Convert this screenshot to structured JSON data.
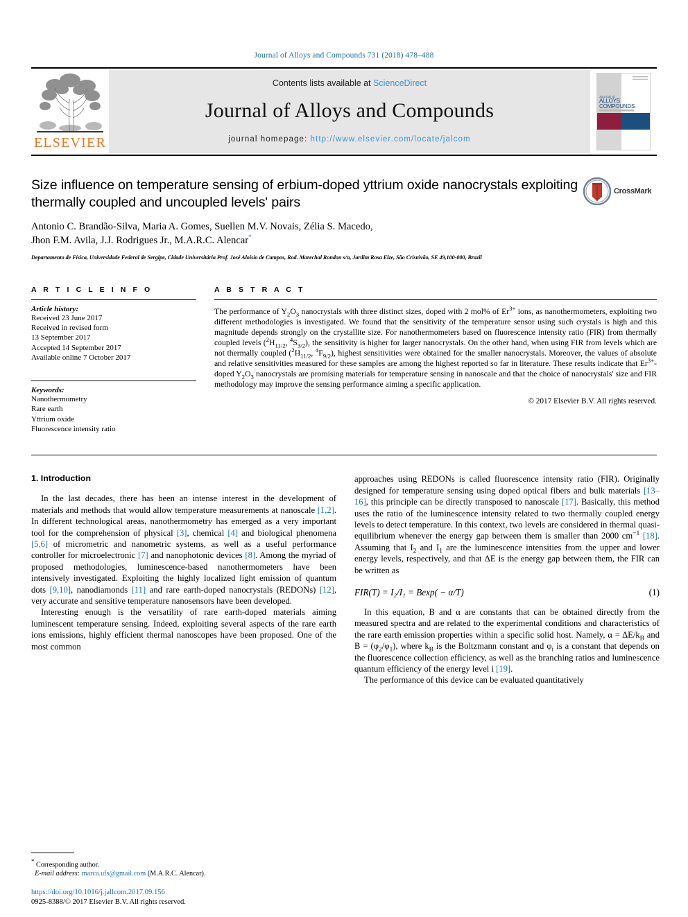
{
  "running_head": "Journal of Alloys and Compounds 731 (2018) 478–488",
  "masthead": {
    "contents_prefix": "Contents lists available at ",
    "sciencedirect": "ScienceDirect",
    "journal_name": "Journal of Alloys and Compounds",
    "homepage_label": "journal homepage: ",
    "homepage_url": "http://www.elsevier.com/locate/jalcom",
    "publisher_logo_text": "ELSEVIER",
    "cover": {
      "line1": "Journal of",
      "line2": "ALLOYS",
      "line3": "COMPOUNDS"
    },
    "colors": {
      "link": "#3a93c9",
      "elsevier_orange": "#e87722",
      "cover_maroon": "#8c1f3d",
      "cover_navy": "#1c4e7e",
      "band_gray": "#e6e6e6"
    }
  },
  "article": {
    "title": "Size influence on temperature sensing of erbium-doped yttrium oxide nanocrystals exploiting thermally coupled and uncoupled levels' pairs",
    "authors_line1": "Antonio C. Brandão-Silva, Maria A. Gomes, Suellen M.V. Novais, Zélia S. Macedo,",
    "authors_line2_pre": "Jhon F.M. Avila, J.J. Rodrigues Jr., M.A.R.C. Alencar",
    "corresponding_marker": "*",
    "affiliation": "Departamento de Física, Universidade Federal de Sergipe, Cidade Universitária Prof. José Aloísio de Campos, Rod. Marechal Rondon s/n, Jardim Rosa Elze, São Cristóvão, SE 49,100-000, Brazil",
    "crossmark_label": "CrossMark"
  },
  "article_info": {
    "heading": "A R T I C L E   I N F O",
    "history_label": "Article history:",
    "history": [
      "Received 23 June 2017",
      "Received in revised form",
      "13 September 2017",
      "Accepted 14 September 2017",
      "Available online 7 October 2017"
    ],
    "keywords_label": "Keywords:",
    "keywords": [
      "Nanothermometry",
      "Rare earth",
      "Yttrium oxide",
      "Fluorescence intensity ratio"
    ]
  },
  "abstract": {
    "heading": "A B S T R A C T",
    "text_parts": {
      "p1": "The performance of Y",
      "p2": "O",
      "p3": " nanocrystals with three distinct sizes, doped with 2 mol% of Er",
      "p4": "3+",
      "p5": " ions, as nanothermometers, exploiting two different methodologies is investigated. We found that the sensitivity of the temperature sensor using such crystals is high and this magnitude depends strongly on the crystallite size. For nanothermometers based on fluorescence intensity ratio (FIR) from thermally coupled levels (",
      "p6": "2",
      "p7": "H",
      "p8": "11/2",
      "p9": ", ",
      "p10": "4",
      "p11": "S",
      "p12": "3/2",
      "p13": "), the sensitivity is higher for larger nanocrystals. On the other hand, when using FIR from levels which are not thermally coupled (",
      "p14": "F",
      "p15": "9/2",
      "p16": "), highest sensitivities were obtained for the smaller nanocrystals. Moreover, the values of absolute and relative sensitivities measured for these samples are among the highest reported so far in literature. These results indicate that Er",
      "p17": "-doped Y",
      "p18": " nanocrystals are promising materials for temperature sensing in nanoscale and that the choice of nanocrystals' size and FIR methodology may improve the sensing performance aiming a specific application."
    },
    "copyright": "© 2017 Elsevier B.V. All rights reserved."
  },
  "body": {
    "section1_title": "1. Introduction",
    "left_col": {
      "par1_a": "In the last decades, there has been an intense interest in the development of materials and methods that would allow temperature measurements at nanoscale ",
      "par1_ref1": "[1,2]",
      "par1_b": ". In different technological areas, nanothermometry has emerged as a very important tool for the comprehension of physical ",
      "par1_ref2": "[3]",
      "par1_c": ", chemical ",
      "par1_ref3": "[4]",
      "par1_d": " and biological phenomena ",
      "par1_ref4": "[5,6]",
      "par1_e": " of micrometric and nanometric systems, as well as a useful performance controller for microelectronic ",
      "par1_ref5": "[7]",
      "par1_f": " and nanophotonic devices ",
      "par1_ref6": "[8]",
      "par1_g": ". Among the myriad of proposed methodologies, luminescence-based nanothermometers have been intensively investigated. Exploiting the highly localized light emission of quantum dots ",
      "par1_ref7": "[9,10]",
      "par1_h": ", nanodiamonds ",
      "par1_ref8": "[11]",
      "par1_i": " and rare earth-doped nanocrystals (REDONs) ",
      "par1_ref9": "[12]",
      "par1_j": ", very accurate and sensitive temperature nanosensors have been developed.",
      "par2": "Interesting enough is the versatility of rare earth-doped materials aiming luminescent temperature sensing. Indeed, exploiting several aspects of the rare earth ions emissions, highly efficient thermal nanoscopes have been proposed. One of the most common"
    },
    "right_col": {
      "par1_a": "approaches using REDONs is called fluorescence intensity ratio (FIR). Originally designed for temperature sensing using doped optical fibers and bulk materials ",
      "par1_ref1": "[13–16]",
      "par1_b": ", this principle can be directly transposed to nanoscale ",
      "par1_ref2": "[17]",
      "par1_c": ". Basically, this method uses the ratio of the luminescence intensity related to two thermally coupled energy levels to detect temperature. In this context, two levels are considered in thermal quasi-equilibrium whenever the energy gap between them is smaller than 2000 cm",
      "par1_sup": "−1",
      "par1_d": " ",
      "par1_ref3": "[18]",
      "par1_e": ". Assuming that I",
      "par1_sub2": "2",
      "par1_f": " and I",
      "par1_sub1": "1",
      "par1_g": " are the luminescence intensities from the upper and lower energy levels, respectively, and that ΔE is the energy gap between them, the FIR can be written as",
      "equation": "FIR(T) = I₂/I₁  = Bexp( − α/T)",
      "equation_number": "(1)",
      "par2_a": "In this equation, B and α are constants that can be obtained directly from the measured spectra and are related to the experimental conditions and characteristics of the rare earth emission properties within a specific solid host. Namely, α = ΔE/k",
      "par2_subB1": "B",
      "par2_b": " and B = (φ",
      "par2_sub2": "2",
      "par2_c": "/φ",
      "par2_sub1": "1",
      "par2_d": "), where k",
      "par2_subB2": "B",
      "par2_e": " is the Boltzmann constant and φ",
      "par2_subi": "i",
      "par2_f": " is a constant that depends on the fluorescence collection efficiency, as well as the branching ratios and luminescence quantum efficiency of the energy level i ",
      "par2_ref": "[19]",
      "par2_g": ".",
      "par3": "The performance of this device can be evaluated quantitatively"
    }
  },
  "footer": {
    "corresponding_star": "*",
    "corresponding_label": " Corresponding author.",
    "email_label": "E-mail address: ",
    "email": "marca.ufs@gmail.com",
    "email_suffix": " (M.A.R.C. Alencar).",
    "doi": "https://doi.org/10.1016/j.jallcom.2017.09.156",
    "issn_line": "0925-8388/© 2017 Elsevier B.V. All rights reserved."
  }
}
